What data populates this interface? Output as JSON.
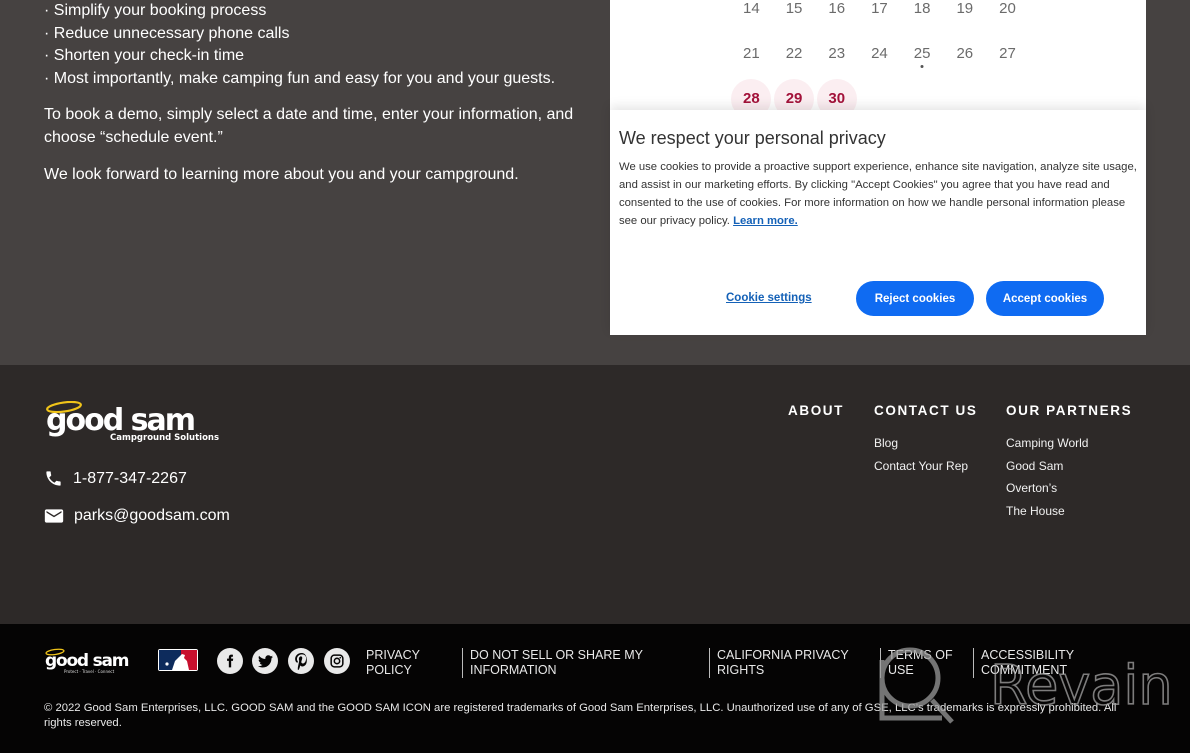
{
  "intro": {
    "bullets": [
      "· Simplify your booking process",
      "· Reduce unnecessary phone calls",
      "· Shorten your check-in time",
      "· Most importantly, make camping fun and easy for you and your guests."
    ],
    "paragraph_demo": "To book a demo, simply select a date and time, enter your information, and choose “schedule event.”",
    "paragraph_closing": "We look forward to learning more about you and your campground."
  },
  "calendar": {
    "rows": [
      [
        "14",
        "15",
        "16",
        "17",
        "18",
        "19",
        "20"
      ],
      [
        "21",
        "22",
        "23",
        "24",
        "25",
        "26",
        "27"
      ],
      [
        "28",
        "29",
        "30"
      ]
    ],
    "today": "25",
    "available_days": [
      "28",
      "29",
      "30"
    ],
    "available_color": "#a3123a"
  },
  "cookie_banner": {
    "title": "We respect your personal privacy",
    "body": "We use cookies to provide a proactive support experience, enhance site navigation, analyze site usage, and assist in our marketing efforts. By clicking \"Accept Cookies\" you agree that you have read and consented to the use of cookies. For more information on how we handle personal information please see our privacy policy.",
    "learn_more": "Learn more.",
    "settings_label": "Cookie settings",
    "reject_label": "Reject cookies",
    "accept_label": "Accept cookies",
    "button_color": "#0f6bf2"
  },
  "footer": {
    "logo_text": "good sam",
    "logo_subtext": "Campground Solutions",
    "phone": "1-877-347-2267",
    "email": "parks@goodsam.com",
    "columns": [
      {
        "heading": "ABOUT",
        "links": []
      },
      {
        "heading": "CONTACT US",
        "links": [
          "Blog",
          "Contact Your Rep"
        ]
      },
      {
        "heading": "OUR PARTNERS",
        "links": [
          "Camping World",
          "Good Sam",
          "Overton’s",
          "The House"
        ]
      }
    ]
  },
  "bottom_bar": {
    "logo_text": "good sam",
    "logo_subtext": "Protect · Travel · Connect",
    "social_icons": [
      "facebook-icon",
      "twitter-icon",
      "pinterest-icon",
      "instagram-icon"
    ],
    "legal_links": [
      "PRIVACY POLICY",
      "DO NOT SELL OR SHARE MY INFORMATION",
      "CALIFORNIA PRIVACY RIGHTS",
      "TERMS OF USE",
      "ACCESSIBILITY COMMITMENT"
    ],
    "copyright": "© 2022 Good Sam Enterprises, LLC. GOOD SAM and the GOOD SAM ICON are registered trademarks of Good Sam Enterprises, LLC. Unauthorized use of any of GSE, LLC’s trademarks is expressly prohibited. All rights reserved."
  },
  "watermark": {
    "text": "Revain"
  }
}
